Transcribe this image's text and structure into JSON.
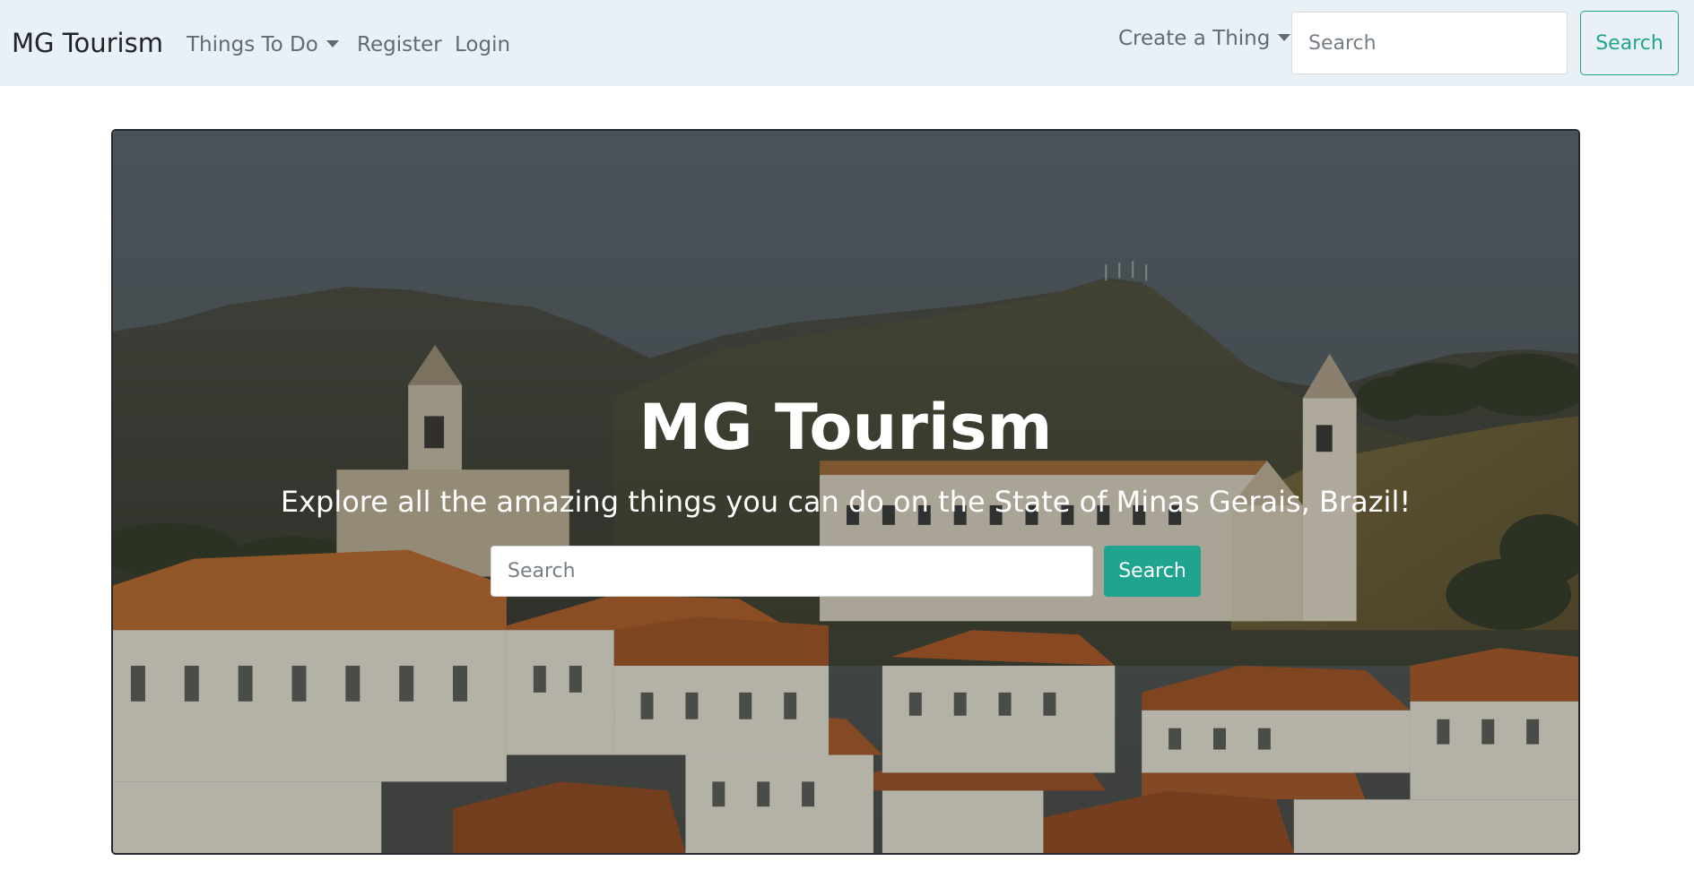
{
  "navbar": {
    "brand": "MG Tourism",
    "things_to_do": "Things To Do",
    "register": "Register",
    "login": "Login",
    "create_a_thing": "Create a Thing",
    "search_placeholder": "Search",
    "search_button": "Search"
  },
  "hero": {
    "title": "MG Tourism",
    "subtitle": "Explore all the amazing things you can do on the State of Minas Gerais, Brazil!",
    "search_placeholder": "Search",
    "search_button": "Search",
    "image": "hero-photo-town-and-mountains"
  },
  "colors": {
    "navbar_bg": "#e9f1f7",
    "accent": "#1fa58f",
    "nav_text": "#636a70",
    "brand_text": "#212529"
  }
}
